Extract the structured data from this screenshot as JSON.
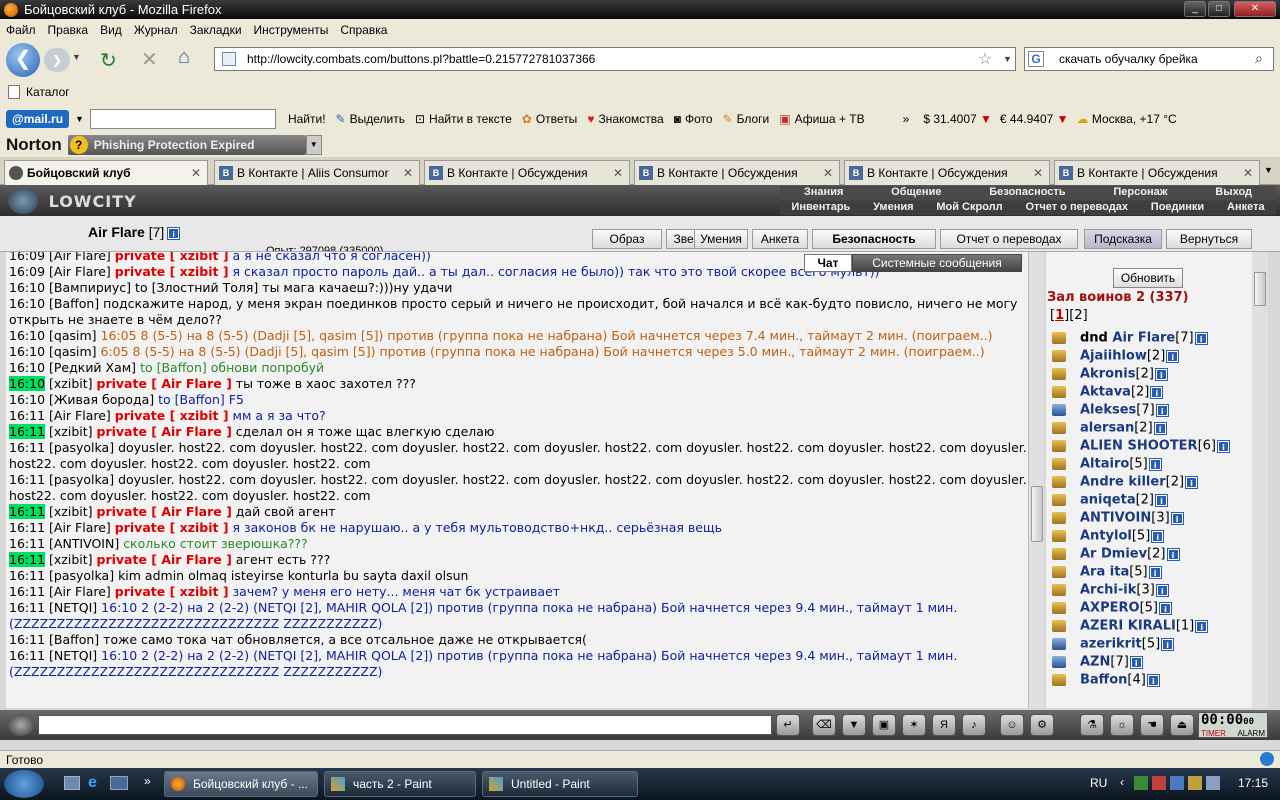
{
  "window": {
    "title": "Бойцовский клуб - Mozilla Firefox"
  },
  "menu": [
    "Файл",
    "Правка",
    "Вид",
    "Журнал",
    "Закладки",
    "Инструменты",
    "Справка"
  ],
  "nav": {
    "url": "http://lowcity.combats.com/buttons.pl?battle=0.215772781037366",
    "search": "скачать обучалку брейка"
  },
  "bookmarks": {
    "item": "Каталог"
  },
  "mailbar": {
    "logo": "@mail.ru",
    "find": "Найти!",
    "items": [
      "Выделить",
      "Найти в тексте",
      "Ответы",
      "Знакомства",
      "Фото",
      "Блоги",
      "Афиша + ТВ"
    ],
    "more": "»",
    "usd": "$ 31.4007",
    "eur": "€ 44.9407",
    "weather": "Москва, +17 °C"
  },
  "norton": {
    "logo": "Norton",
    "alert": "Phishing Protection Expired"
  },
  "tabs": [
    {
      "label": "Бойцовский клуб"
    },
    {
      "label": "В Контакте | Aliis Consumor"
    },
    {
      "label": "В Контакте | Обсуждения"
    },
    {
      "label": "В Контакте | Обсуждения"
    },
    {
      "label": "В Контакте | Обсуждения"
    },
    {
      "label": "В Контакте | Обсуждения"
    }
  ],
  "game": {
    "logo": "LOWCITY",
    "topmenu1": [
      "Знания",
      "Общение",
      "Безопасность",
      "Персонаж",
      "Выход"
    ],
    "topmenu2": [
      "Инвентарь",
      "Умения",
      "Мой Скролл",
      "Отчет о переводах",
      "Поединки",
      "Анкета"
    ],
    "character": {
      "name": "Air Flare",
      "level": "[7]"
    },
    "exp": "Опыт: 297098 (335000)",
    "buttons": [
      "Образ",
      "Зверь",
      "Умения",
      "Анкета",
      "Безопасность",
      "Отчет о переводах",
      "Подсказка",
      "Вернуться"
    ],
    "chat_tabs": {
      "chat": "Чат",
      "system": "Системные сообщения"
    },
    "refresh": "Обновить",
    "room": "Зал воинов 2 (337)",
    "pages": [
      "1",
      "2"
    ]
  },
  "chat": [
    {
      "t": "16:09",
      "n": "[Air Flare]",
      "p": "private [ xzibit ]",
      "m": "а я не сказал что я согласен))",
      "c": "blue"
    },
    {
      "t": "16:09",
      "n": "[Air Flare]",
      "p": "private [ xzibit ]",
      "m": "я сказал просто пароль дай.. а ты дал.. согласия не было)) так что это твой скорее всего мульт))",
      "c": "blue"
    },
    {
      "t": "16:10",
      "n": "[Вампириус]",
      "p": "",
      "m": "to [Злостний Толя] ты мага качаеш?:)))ну удачи",
      "c": ""
    },
    {
      "t": "16:10",
      "n": "[Baffon]",
      "p": "",
      "m": "подскажите народ, у меня экран поединков просто серый и ничего не происходит, бой начался и всё как-будто повисло, ничего не могу открыть не знаете в чём дело??",
      "c": ""
    },
    {
      "t": "16:10",
      "n": "[qasim]",
      "p": "",
      "m": "16:05 8 (5-5) на 8 (5-5) (Dadji [5], qasim [5]) против (группа пока не набрана) Бой начнется через 7.4 мин., таймаут 2 мин. (поиграем..)",
      "c": "orange"
    },
    {
      "t": "16:10",
      "n": "[qasim]",
      "p": "",
      "m": "6:05 8 (5-5) на 8 (5-5) (Dadji [5], qasim [5]) против (группа пока не набрана) Бой начнется через 5.0 мин., таймаут 2 мин. (поиграем..)",
      "c": "orange"
    },
    {
      "t": "16:10",
      "n": "[Редкий Хам]",
      "p": "",
      "m": "to [Baffon] обнови попробуй",
      "c": "green"
    },
    {
      "t": "16:10",
      "n": "[xzibit]",
      "p": "private [ Air Flare ]",
      "m": "ты тоже в хаос захотел ???",
      "c": "",
      "hl": true
    },
    {
      "t": "16:10",
      "n": "[Живая борода]",
      "p": "",
      "m": "to [Baffon] F5",
      "c": "blue"
    },
    {
      "t": "16:11",
      "n": "[Air Flare]",
      "p": "private [ xzibit ]",
      "m": "мм а я за что?",
      "c": "blue"
    },
    {
      "t": "16:11",
      "n": "[xzibit]",
      "p": "private [ Air Flare ]",
      "m": "сделал он я тоже щас влегкую сделаю",
      "c": "",
      "hl": true
    },
    {
      "t": "16:11",
      "n": "[pasyolka]",
      "p": "",
      "m": "doyusler. host22. com doyusler. host22. com doyusler. host22. com doyusler. host22. com doyusler. host22. com doyusler. host22. com doyusler. host22. com doyusler. host22. com doyusler. host22. com",
      "c": ""
    },
    {
      "t": "16:11",
      "n": "[pasyolka]",
      "p": "",
      "m": "doyusler. host22. com doyusler. host22. com doyusler. host22. com doyusler. host22. com doyusler. host22. com doyusler. host22. com doyusler. host22. com doyusler. host22. com doyusler. host22. com",
      "c": ""
    },
    {
      "t": "16:11",
      "n": "[xzibit]",
      "p": "private [ Air Flare ]",
      "m": "дай свой агент",
      "c": "",
      "hl": true
    },
    {
      "t": "16:11",
      "n": "[Air Flare]",
      "p": "private [ xzibit ]",
      "m": "я законов бк не нарушаю.. а у тебя мультоводство+нкд.. серьёзная вещь",
      "c": "blue"
    },
    {
      "t": "16:11",
      "n": "[ANTIVOIN]",
      "p": "",
      "m": "сколько стоит зверюшка???",
      "c": "green"
    },
    {
      "t": "16:11",
      "n": "[xzibit]",
      "p": "private [ Air Flare ]",
      "m": "агент есть ???",
      "c": "",
      "hl": true
    },
    {
      "t": "16:11",
      "n": "[pasyolka]",
      "p": "",
      "m": "kim admin olmaq isteyirse konturla bu sayta daxil olsun",
      "c": ""
    },
    {
      "t": "16:11",
      "n": "[Air Flare]",
      "p": "private [ xzibit ]",
      "m": "зачем? у меня его нету... меня чат бк устраивает",
      "c": "blue"
    },
    {
      "t": "16:11",
      "n": "[NETQI]",
      "p": "",
      "m": "16:10 2 (2-2) на 2 (2-2) (NETQI [2], MAHIR QOLA [2]) против (группа пока не набрана) Бой начнется через 9.4 мин., таймаут 1 мин. (ZZZZZZZZZZZZZZZZZZZZZZZZZZZZZZZ ZZZZZZZZZZZ)",
      "c": "blue"
    },
    {
      "t": "16:11",
      "n": "[Baffon]",
      "p": "",
      "m": "тоже само тока чат обновляется, а все отсальное даже не открывается(",
      "c": ""
    },
    {
      "t": "16:11",
      "n": "[NETQI]",
      "p": "",
      "m": "16:10 2 (2-2) на 2 (2-2) (NETQI [2], MAHIR QOLA [2]) против (группа пока не набрана) Бой начнется через 9.4 мин., таймаут 1 мин. (ZZZZZZZZZZZZZZZZZZZZZZZZZZZZZZZ ZZZZZZZZZZZ)",
      "c": "blue"
    }
  ],
  "players": [
    {
      "pre": "dnd ",
      "name": "Air Flare",
      "lvl": "[7]",
      "alt": false
    },
    {
      "pre": "",
      "name": "Ajaiihlow",
      "lvl": "[2]",
      "alt": false
    },
    {
      "pre": "",
      "name": "Akronis",
      "lvl": "[2]",
      "alt": false
    },
    {
      "pre": "",
      "name": "Aktava",
      "lvl": "[2]",
      "alt": false
    },
    {
      "pre": "",
      "name": "Alekses",
      "lvl": "[7]",
      "alt": true
    },
    {
      "pre": "",
      "name": "alersan",
      "lvl": "[2]",
      "alt": false
    },
    {
      "pre": "",
      "name": "ALIEN SHOOTER",
      "lvl": "[6]",
      "alt": false
    },
    {
      "pre": "",
      "name": "Altairo",
      "lvl": "[5]",
      "alt": false
    },
    {
      "pre": "",
      "name": "Andre killer",
      "lvl": "[2]",
      "alt": false
    },
    {
      "pre": "",
      "name": "aniqeta",
      "lvl": "[2]",
      "alt": false
    },
    {
      "pre": "",
      "name": "ANTIVOIN",
      "lvl": "[3]",
      "alt": false
    },
    {
      "pre": "",
      "name": "Antylol",
      "lvl": "[5]",
      "alt": false
    },
    {
      "pre": "",
      "name": "Ar Dmiev",
      "lvl": "[2]",
      "alt": false
    },
    {
      "pre": "",
      "name": "Ara ita",
      "lvl": "[5]",
      "alt": false
    },
    {
      "pre": "",
      "name": "Archi-ik",
      "lvl": "[3]",
      "alt": false
    },
    {
      "pre": "",
      "name": "AXPERO",
      "lvl": "[5]",
      "alt": false
    },
    {
      "pre": "",
      "name": "AZERI KIRALI",
      "lvl": "[1]",
      "alt": false
    },
    {
      "pre": "",
      "name": "azerikrit",
      "lvl": "[5]",
      "alt": true
    },
    {
      "pre": "",
      "name": "AZN",
      "lvl": "[7]",
      "alt": true
    },
    {
      "pre": "",
      "name": "Baffon",
      "lvl": "[4]",
      "alt": false
    }
  ],
  "timer": {
    "time": "00:00",
    "sec": "00",
    "timer_label": "TIMER",
    "alarm_label": "ALARM"
  },
  "status": "Готово",
  "taskbar": {
    "items": [
      "Бойцовский клуб - ...",
      "часть 2 - Paint",
      "Untitled - Paint"
    ],
    "lang": "RU",
    "clock": "17:15"
  }
}
